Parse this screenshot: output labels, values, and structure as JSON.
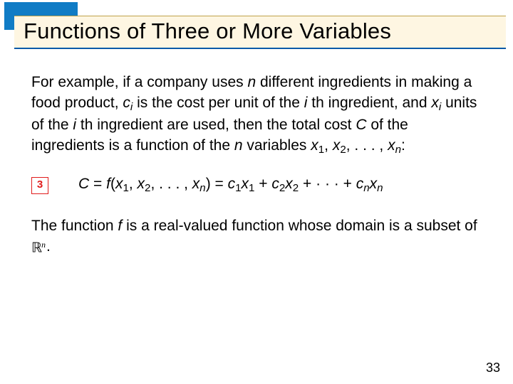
{
  "header": {
    "title": "Functions of Three or More Variables"
  },
  "body": {
    "para1_pre": "For example, if a company uses ",
    "n": "n",
    "para1_a": " different ingredients in making a food product, ",
    "ci_c": "c",
    "ci_i": "i",
    "para1_b": " is the cost per unit of the ",
    "ith_i": "i ",
    "ith_th": "th ingredient, and ",
    "xi_x": "x",
    "xi_i": "i",
    "para1_c": " units of the ",
    "ith2_i": "i ",
    "ith2_th": "th ingredient are used, then the total cost ",
    "C": "C",
    "para1_d": " of the ingredients is a function of the ",
    "n2": "n",
    "para1_e": " variables ",
    "x": "x",
    "s1": "1",
    "comma": ", ",
    "s2": "2",
    "ell": ", . . . , ",
    "sn": "n",
    "colon": ":"
  },
  "eq": {
    "badge": "3",
    "C": "C",
    "eq": " = ",
    "f": "f",
    "lp": "(",
    "x": "x",
    "s1": "1",
    "comma": ", ",
    "s2": "2",
    "ell": ", . . . , ",
    "sn": "n",
    "rp": ") = ",
    "c": "c",
    "plus": " + ",
    "cdots": " + · · · + "
  },
  "para2": {
    "a": "The function ",
    "f": "f",
    "b": " is a real-valued function whose domain is a subset of ",
    "Rn_R": "ℝ",
    "Rn_n": "n",
    "period": "."
  },
  "page": "33"
}
